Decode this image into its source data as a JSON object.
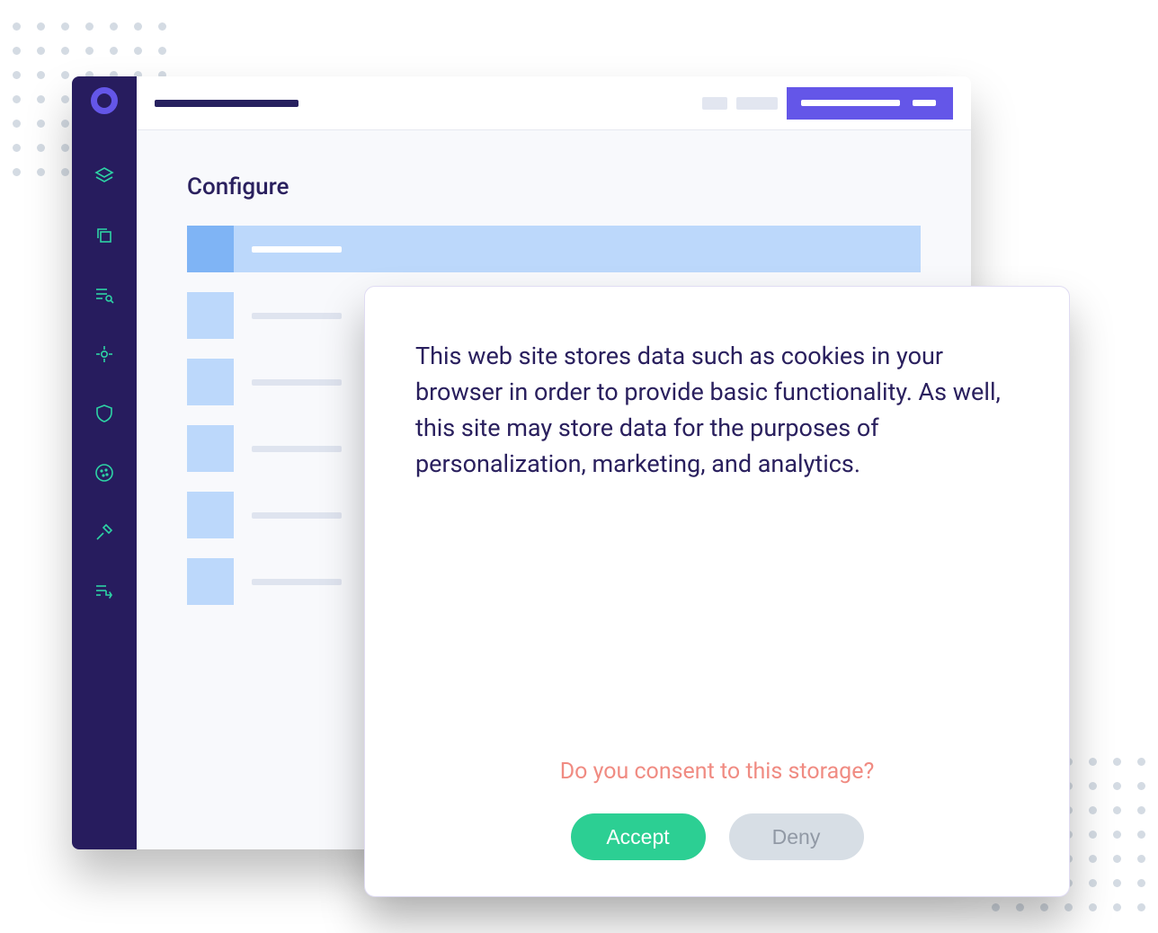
{
  "page": {
    "heading": "Configure"
  },
  "consent": {
    "body": "This web site stores data such as cookies in your browser in order to provide basic functionality. As well, this site may store data for the purposes of personalization, marketing, and analytics.",
    "question": "Do you consent to this storage?",
    "accept_label": "Accept",
    "deny_label": "Deny"
  },
  "sidebar_icons": [
    "layers-icon",
    "copy-icon",
    "list-search-icon",
    "target-icon",
    "shield-icon",
    "cookie-icon",
    "gavel-icon",
    "flow-icon"
  ]
}
